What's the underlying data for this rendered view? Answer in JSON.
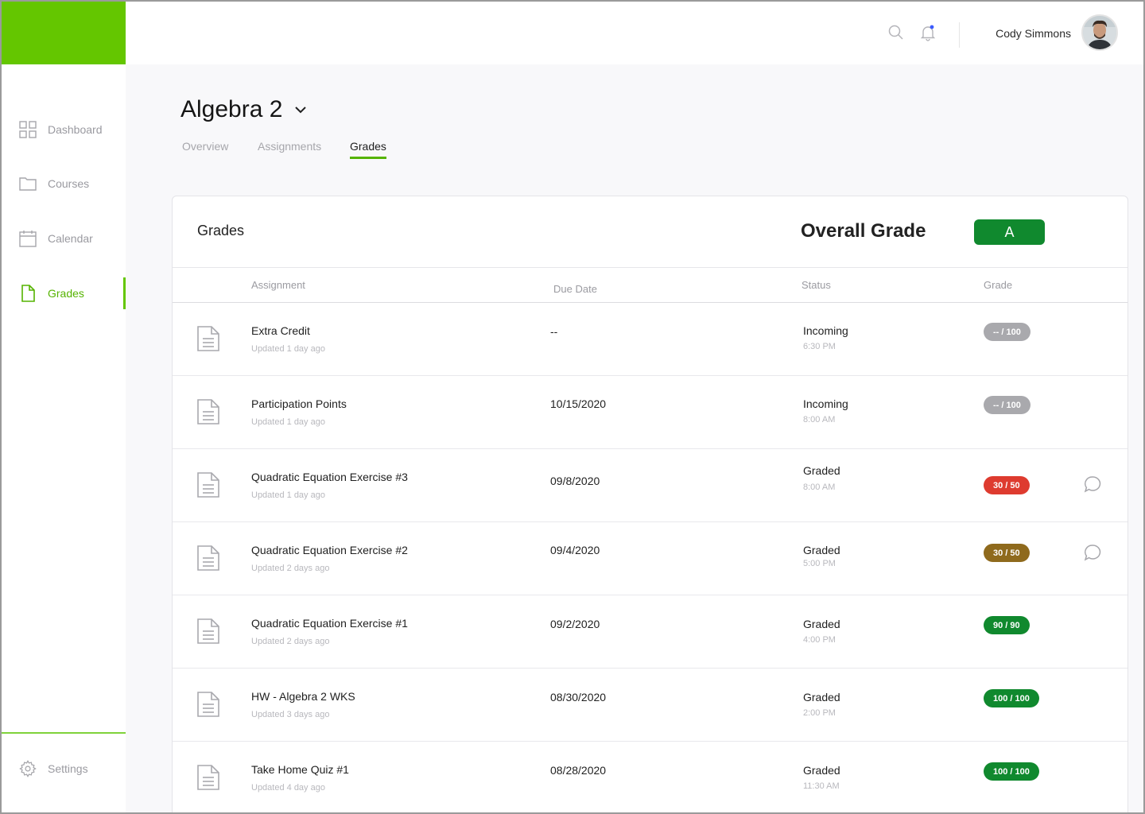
{
  "sidebar": {
    "items": [
      {
        "label": "Dashboard",
        "icon": "grid-icon"
      },
      {
        "label": "Courses",
        "icon": "folder-icon"
      },
      {
        "label": "Calendar",
        "icon": "calendar-icon"
      },
      {
        "label": "Grades",
        "icon": "document-icon",
        "active": true
      }
    ],
    "settings_label": "Settings"
  },
  "header": {
    "user_name": "Cody Simmons",
    "notification_dot_color": "#3b5bff"
  },
  "course": {
    "title": "Algebra 2",
    "tabs": [
      {
        "label": "Overview"
      },
      {
        "label": "Assignments"
      },
      {
        "label": "Grades",
        "active": true
      }
    ]
  },
  "grades": {
    "title": "Grades",
    "overall_label": "Overall Grade",
    "overall_value": "A",
    "columns": {
      "assignment": "Assignment",
      "due_date": "Due Date",
      "status": "Status",
      "grade": "Grade"
    },
    "rows": [
      {
        "name": "Extra Credit",
        "updated": "Updated 1 day ago",
        "due": "--",
        "status": "Incoming",
        "time": "6:30 PM",
        "grade": "-- / 100",
        "grade_color": "#a9a9ad",
        "comment": false
      },
      {
        "name": "Participation Points",
        "updated": "Updated 1 day ago",
        "due": "10/15/2020",
        "status": "Incoming",
        "time": "8:00 AM",
        "grade": "-- / 100",
        "grade_color": "#a9a9ad",
        "comment": false
      },
      {
        "name": "Quadratic Equation Exercise #3",
        "updated": "Updated 1 day ago",
        "due": "09/8/2020",
        "status": "Graded",
        "time": "8:00 AM",
        "grade": "30 / 50",
        "grade_color": "#de3b2f",
        "comment": true
      },
      {
        "name": "Quadratic Equation Exercise #2",
        "updated": "Updated 2 days ago",
        "due": "09/4/2020",
        "status": "Graded",
        "time": "5:00 PM",
        "grade": "30 / 50",
        "grade_color": "#8f6a1d",
        "comment": true
      },
      {
        "name": "Quadratic Equation Exercise #1",
        "updated": "Updated 2 days ago",
        "due": "09/2/2020",
        "status": "Graded",
        "time": "4:00 PM",
        "grade": "90 / 90",
        "grade_color": "#10892e",
        "comment": false
      },
      {
        "name": "HW - Algebra 2 WKS",
        "updated": "Updated 3 days ago",
        "due": "08/30/2020",
        "status": "Graded",
        "time": "2:00 PM",
        "grade": "100 / 100",
        "grade_color": "#10892e",
        "comment": false
      },
      {
        "name": "Take Home Quiz #1",
        "updated": "Updated 4 day ago",
        "due": "08/28/2020",
        "status": "Graded",
        "time": "11:30 AM",
        "grade": "100 / 100",
        "grade_color": "#10892e",
        "comment": false
      }
    ]
  }
}
